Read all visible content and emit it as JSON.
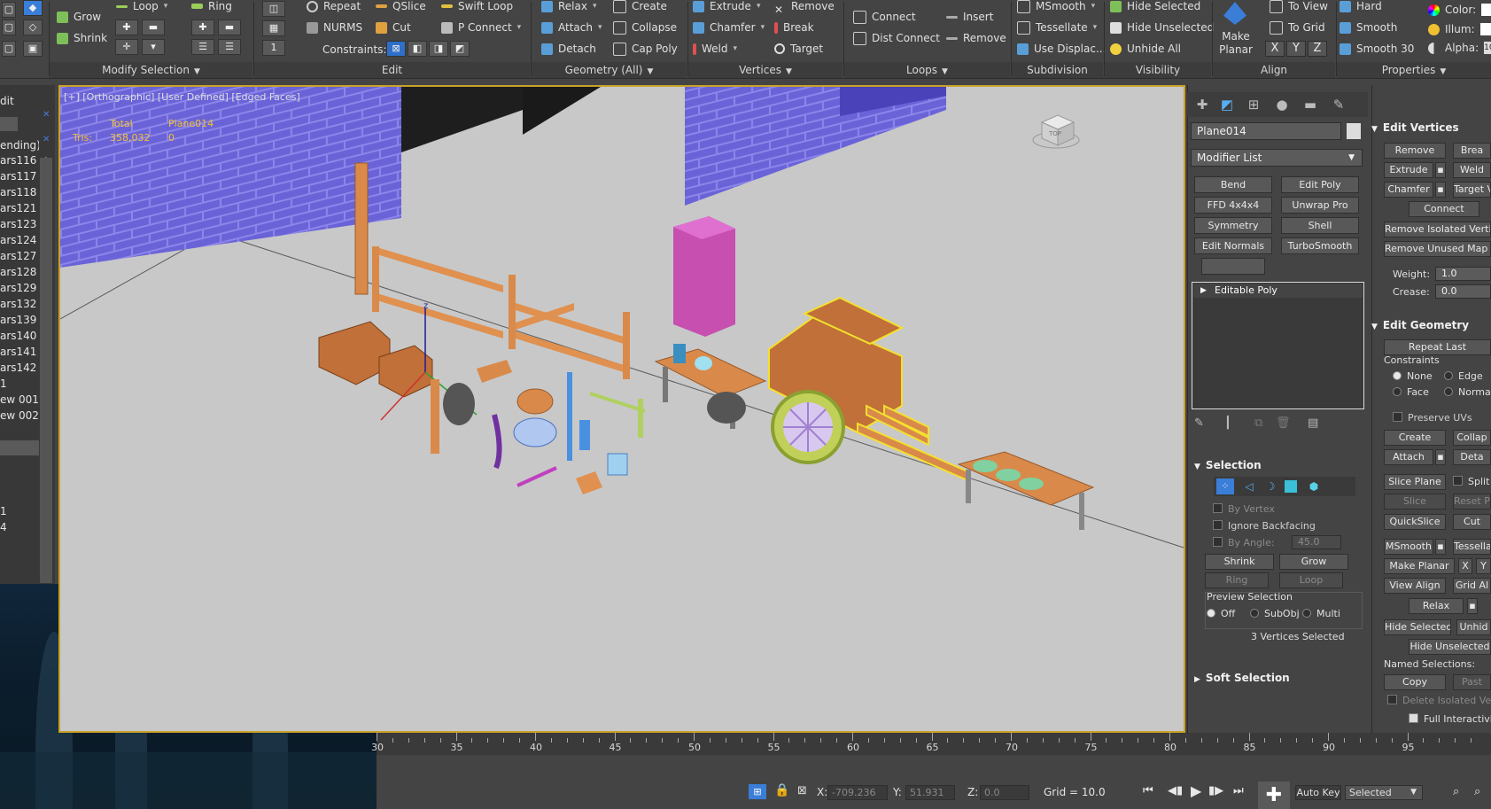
{
  "ribbon": {
    "groups": {
      "modify_selection": "Modify Selection",
      "edit": "Edit",
      "geometry": "Geometry (All)",
      "vertices": "Vertices",
      "loops": "Loops",
      "subdivision": "Subdivision",
      "visibility": "Visibility",
      "align": "Align",
      "properties": "Properties"
    },
    "items": {
      "grow": "Grow",
      "shrink": "Shrink",
      "loop": "Loop",
      "ring": "Ring",
      "repeat": "Repeat",
      "qslice": "QSlice",
      "swift_loop": "Swift Loop",
      "nurms": "NURMS",
      "cut": "Cut",
      "p_connect": "P Connect",
      "constraints": "Constraints:",
      "relax": "Relax",
      "create": "Create",
      "attach": "Attach",
      "collapse": "Collapse",
      "detach": "Detach",
      "cap_poly": "Cap Poly",
      "extrude": "Extrude",
      "remove": "Remove",
      "chamfer": "Chamfer",
      "break": "Break",
      "weld": "Weld",
      "target": "Target",
      "connect": "Connect",
      "insert": "Insert",
      "dist_connect": "Dist Connect",
      "loops_remove": "Remove",
      "msmooth": "MSmooth",
      "tessellate": "Tessellate",
      "use_displace": "Use Displac...",
      "hide_selected": "Hide Selected",
      "hide_unselected": "Hide Unselected",
      "unhide_all": "Unhide All",
      "make_planar": "Make Planar",
      "to_view": "To View",
      "to_grid": "To Grid",
      "x": "X",
      "y": "Y",
      "z": "Z",
      "hard": "Hard",
      "smooth": "Smooth",
      "smooth_30": "Smooth 30",
      "color": "Color:",
      "illum": "Illum:",
      "alpha": "Alpha:",
      "alpha_value": "10"
    }
  },
  "scene_list": {
    "header": "dit",
    "pending": "ending)",
    "rows": [
      "ars116",
      "ars117",
      "ars118",
      "ars121",
      "ars123",
      "ars124",
      "ars127",
      "ars128",
      "ars129",
      "ars132",
      "ars139",
      "ars140",
      "ars141",
      "ars142",
      "1",
      "ew 001",
      "ew 002",
      "",
      "",
      "",
      "",
      "",
      "1",
      "4"
    ]
  },
  "viewport": {
    "label": "[+] [Orthographic] [User Defined] [Edged Faces]",
    "stats_total": "Total",
    "stats_object": "Plane014",
    "tris_label": "Tris:",
    "tris_total": "358,032",
    "tris_object": "0",
    "gizmo_axis": "z",
    "viewcube_label": "TOP"
  },
  "command_panel": {
    "object_name": "Plane014",
    "modifier_list": "Modifier List",
    "modifiers": [
      "Bend",
      "Edit Poly",
      "FFD 4x4x4",
      "Unwrap Pro",
      "Symmetry",
      "Shell",
      "Edit Normals",
      "TurboSmooth"
    ],
    "stack_item": "Editable Poly",
    "selection": {
      "title": "Selection",
      "by_vertex": "By Vertex",
      "ignore_backfacing": "Ignore Backfacing",
      "by_angle": "By Angle:",
      "angle_value": "45.0",
      "shrink": "Shrink",
      "grow": "Grow",
      "ring": "Ring",
      "loop": "Loop",
      "preview_selection": "Preview Selection",
      "off": "Off",
      "subobj": "SubObj",
      "multi": "Multi",
      "status": "3 Vertices Selected"
    },
    "soft_selection": "Soft Selection"
  },
  "edit_panel": {
    "edit_vertices": "Edit Vertices",
    "remove": "Remove",
    "break": "Brea",
    "extrude": "Extrude",
    "weld": "Weld",
    "chamfer": "Chamfer",
    "target_weld": "Target V",
    "connect": "Connect",
    "remove_isolated": "Remove Isolated Verti",
    "remove_unused": "Remove Unused Map V",
    "weight_label": "Weight:",
    "weight_value": "1.0",
    "crease_label": "Crease:",
    "crease_value": "0.0",
    "edit_geometry": "Edit Geometry",
    "repeat_last": "Repeat Last",
    "constraints": "Constraints",
    "none": "None",
    "edge": "Edge",
    "face": "Face",
    "normal": "Normal",
    "preserve_uvs": "Preserve UVs",
    "create": "Create",
    "collapse": "Collap",
    "attach": "Attach",
    "detach": "Deta",
    "slice_plane": "Slice Plane",
    "split": "Split",
    "slice": "Slice",
    "reset_plane": "Reset Pl",
    "quickslice": "QuickSlice",
    "cut": "Cut",
    "msmooth": "MSmooth",
    "tessellate": "Tessellat",
    "make_planar": "Make Planar",
    "x": "X",
    "y": "Y",
    "view_align": "View Align",
    "grid_align": "Grid Al",
    "relax": "Relax",
    "hide_selected": "Hide Selected",
    "unhide": "Unhid",
    "hide_unselected": "Hide Unselected",
    "named_selections": "Named Selections:",
    "copy": "Copy",
    "paste": "Past",
    "delete_isolated": "Delete Isolated Vertic",
    "full_interactivity": "Full Interactivity"
  },
  "timeline": {
    "labels": [
      "30",
      "35",
      "40",
      "45",
      "50",
      "55",
      "60",
      "65",
      "70",
      "75",
      "80",
      "85",
      "90",
      "95"
    ]
  },
  "status_bar": {
    "x_label": "X:",
    "x_value": "-709.236",
    "y_label": "Y:",
    "y_value": "51.931",
    "z_label": "Z:",
    "z_value": "0.0",
    "grid": "Grid = 10.0",
    "auto_key": "Auto Key",
    "selected": "Selected"
  },
  "colors": {
    "accent_blue": "#3a7ed8",
    "viewport_bg": "#c8c8c8",
    "brick": "#6a63d8",
    "wood": "#d98a4a",
    "magenta": "#c64fb0",
    "selection_yellow": "#f2e030",
    "stat_yellow": "#f2c130"
  }
}
